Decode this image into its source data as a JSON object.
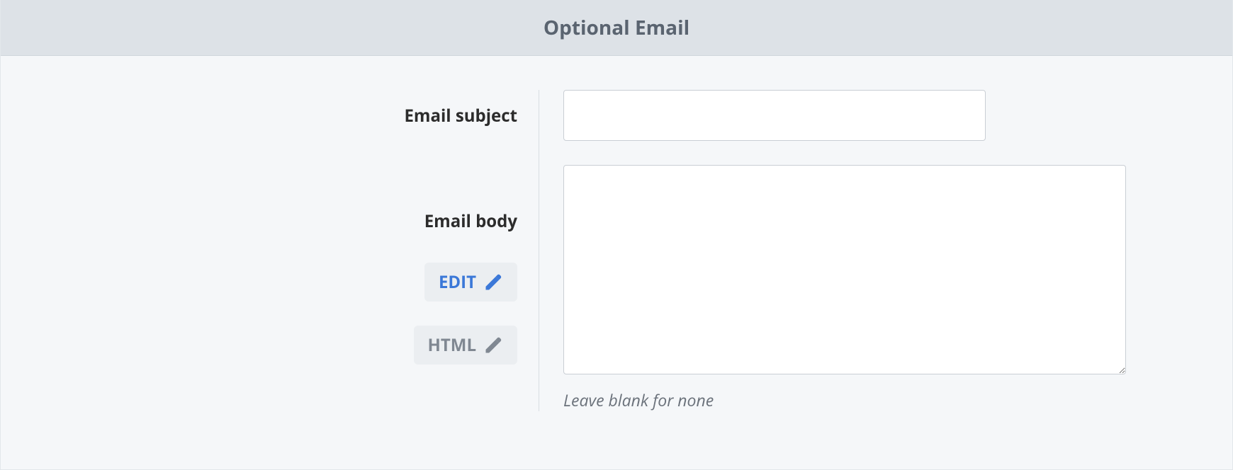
{
  "header": {
    "title": "Optional Email"
  },
  "form": {
    "subject": {
      "label": "Email subject",
      "value": ""
    },
    "body": {
      "label": "Email body",
      "value": "",
      "hint": "Leave blank for none"
    },
    "buttons": {
      "edit": "EDIT",
      "html": "HTML"
    }
  }
}
